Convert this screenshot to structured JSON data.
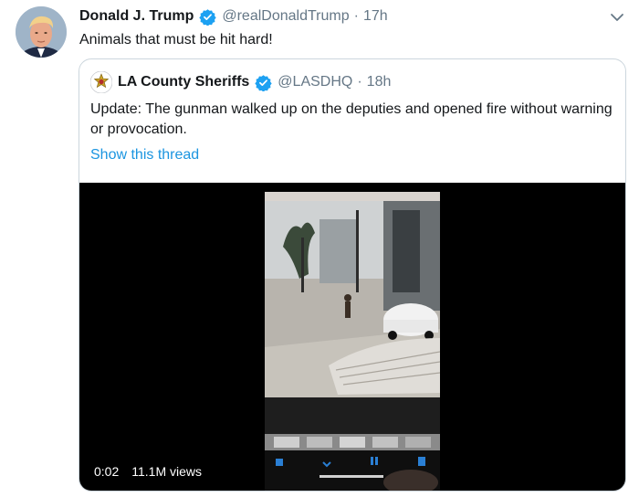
{
  "tweet": {
    "author_name": "Donald J. Trump",
    "handle": "@realDonaldTrump",
    "separator": "·",
    "time": "17h",
    "text": "Animals that must be hit hard!",
    "avatar_icon": "avatar-photo",
    "verified_icon": "verified-badge-icon",
    "menu_icon": "chevron-down-icon"
  },
  "quoted": {
    "author_name": "LA County Sheriffs",
    "handle": "@LASDHQ",
    "separator": "·",
    "time": "18h",
    "text": "Update: The gunman walked up on the deputies and opened fire without warning or provocation.",
    "show_thread": "Show this thread",
    "avatar_icon": "sheriff-badge-avatar"
  },
  "video": {
    "elapsed": "0:02",
    "views": "11.1M views"
  },
  "colors": {
    "text": "#14171a",
    "secondary": "#657786",
    "link": "#1b95e0",
    "verified": "#1da1f2",
    "border": "#ccd6dd"
  }
}
